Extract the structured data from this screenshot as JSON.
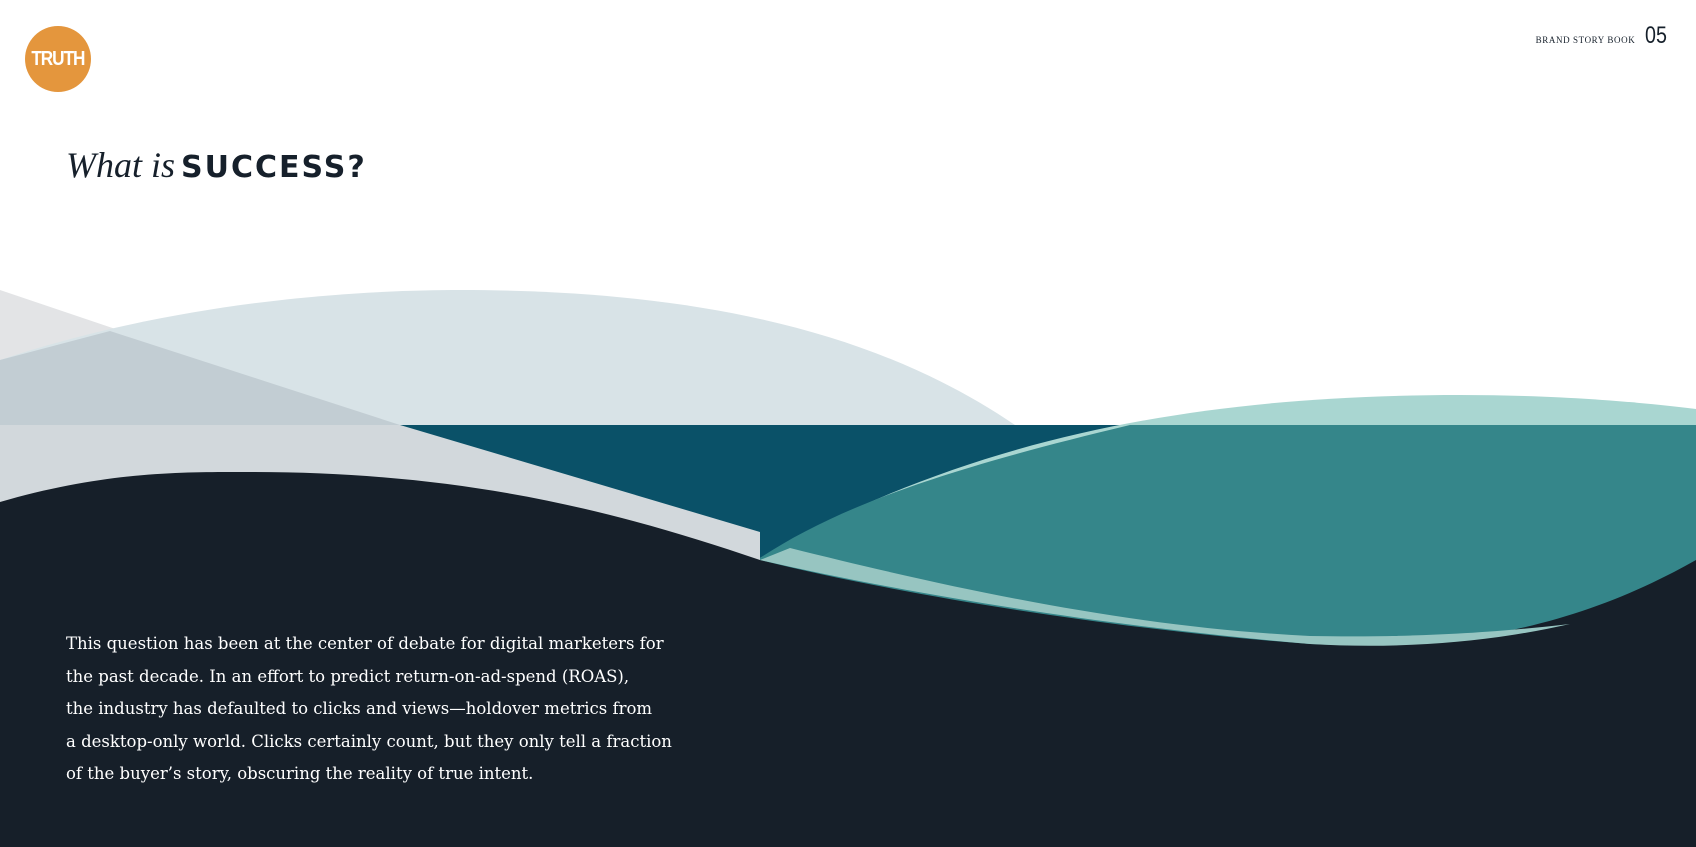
{
  "logo": {
    "text": "TRUTH",
    "color": "#E4963D"
  },
  "header": {
    "book_label": "BRAND STORY BOOK",
    "page_number": "05"
  },
  "headline": {
    "lead": "What is",
    "emphasis": "SUCCESS?"
  },
  "body": {
    "lines": [
      "This question has been at the center of debate for digital marketers for",
      "the past decade. In an effort to predict return-on-ad-spend (ROAS),",
      "the industry has defaulted to clicks and views—holdover metrics from",
      "a desktop-only world. Clicks certainly count, but they only tell a fraction",
      "of the buyer’s story, obscuring the reality of true intent."
    ]
  },
  "colors": {
    "text_dark": "#16202B",
    "navy": "#161F29",
    "deep_teal": "#0A5168",
    "teal": "#35868A",
    "light_teal": "#A9D6D1",
    "pale_blue": "#D8E3E7",
    "pale_gray": "#E3E4E6",
    "gray_blue": "#D2D8DC"
  }
}
